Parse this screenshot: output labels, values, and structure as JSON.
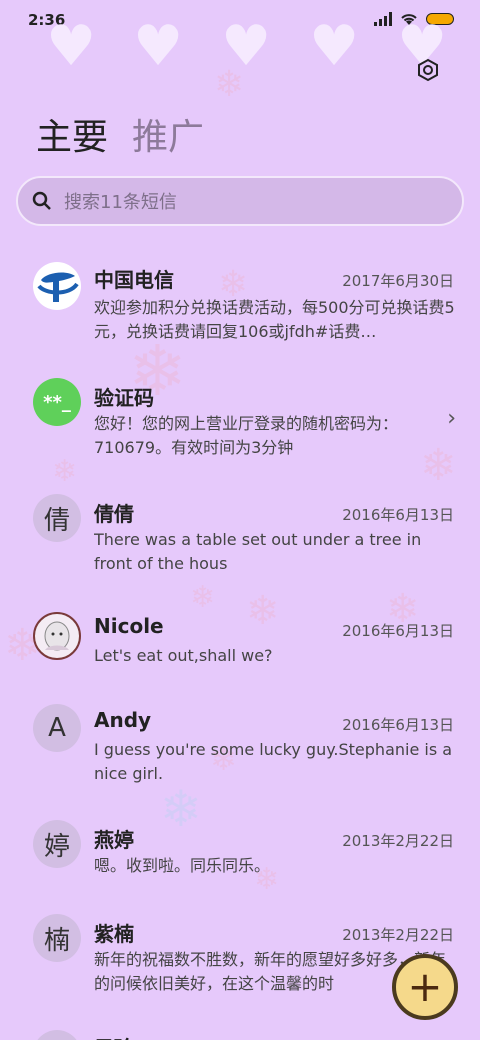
{
  "status": {
    "time": "2:36"
  },
  "tabs": [
    {
      "label": "主要"
    },
    {
      "label": "推广"
    }
  ],
  "search": {
    "placeholder": "搜索11条短信"
  },
  "messages": [
    {
      "name": "中国电信",
      "date": "2017年6月30日",
      "preview": "欢迎参加积分兑换话费活动，每500分可兑换话费5元，兑换话费请回复106或jfdh#话费…",
      "avatar": ""
    },
    {
      "name": "验证码",
      "date": "",
      "preview": "您好！您的网上营业厅登录的随机密码为：710679。有效时间为3分钟",
      "avatar": "**_"
    },
    {
      "name": "倩倩",
      "date": "2016年6月13日",
      "preview": "There was a table set out under a tree in front of the hous",
      "avatar": "倩"
    },
    {
      "name": "Nicole",
      "date": "2016年6月13日",
      "preview": "Let's eat out,shall we?",
      "avatar": ""
    },
    {
      "name": "Andy",
      "date": "2016年6月13日",
      "preview": "I guess you're some lucky guy.Stephanie is a nice girl.",
      "avatar": "A"
    },
    {
      "name": "燕婷",
      "date": "2013年2月22日",
      "preview": "嗯。收到啦。同乐同乐。",
      "avatar": "婷"
    },
    {
      "name": "紫楠",
      "date": "2013年2月22日",
      "preview": "新年的祝福数不胜数，新年的愿望好多好多，新年的问候依旧美好，在这个温馨的时",
      "avatar": "楠"
    },
    {
      "name": "子玲",
      "date": "",
      "preview": "",
      "avatar": ""
    }
  ],
  "fab": {
    "label": "+"
  },
  "colors": {
    "background": "#e6c9fb",
    "verify_green": "#5fd05a",
    "fab": "#f5d98b",
    "telecom_blue": "#1c5fb0"
  }
}
